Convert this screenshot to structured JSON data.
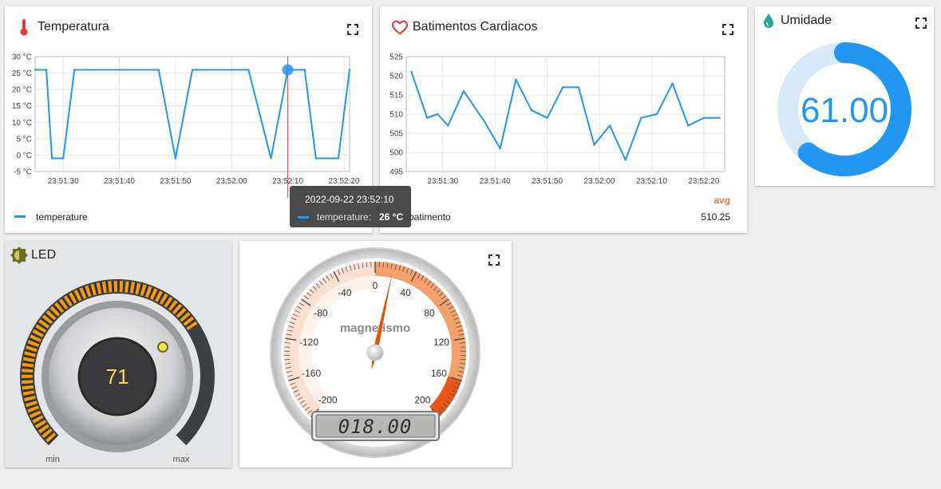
{
  "temperature_card": {
    "title": "Temperatura",
    "icon": "thermometer-icon",
    "legend_label": "temperature",
    "tooltip": {
      "date": "2022-09-22 23:52:10",
      "series": "temperature:",
      "value": "26 °C"
    }
  },
  "heart_card": {
    "title": "Batimentos Cardiacos",
    "icon": "heart-icon",
    "legend_label": "batimento",
    "avg_label": "avg",
    "avg_value": "510.25"
  },
  "humidity_card": {
    "title": "Umidade",
    "icon": "water-drop-icon",
    "value_text": "61.00",
    "value": 61.0,
    "max": 100,
    "colors": {
      "arc": "#2196f3",
      "track": "#d7e9fb"
    }
  },
  "led_card": {
    "title": "LED",
    "icon": "light-bulb-icon",
    "value": "71",
    "min_label": "min",
    "max_label": "max",
    "level": 0.71
  },
  "gauge_card": {
    "title": "magnetismo",
    "lcd_value": "018.00",
    "value": 18,
    "min": -200,
    "max": 200,
    "tick_labels": [
      "-200",
      "-160",
      "-120",
      "-80",
      "-40",
      "0",
      "40",
      "80",
      "120",
      "160",
      "200"
    ]
  },
  "chart_data": [
    {
      "type": "line",
      "title": "Temperatura",
      "series": [
        {
          "name": "temperature",
          "x": [
            "23:51:25",
            "23:51:27",
            "23:51:28",
            "23:51:30",
            "23:51:32",
            "23:51:34",
            "23:51:41",
            "23:51:47",
            "23:51:50",
            "23:51:53",
            "23:52:03",
            "23:52:07",
            "23:52:10",
            "23:52:13",
            "23:52:15",
            "23:52:19",
            "23:52:21"
          ],
          "values": [
            26,
            26,
            -1,
            -1,
            26,
            26,
            26,
            26,
            -1,
            26,
            26,
            -1,
            26,
            26,
            -1,
            -1,
            26
          ]
        }
      ],
      "x_ticks": [
        "23:51:30",
        "23:51:40",
        "23:51:50",
        "23:52:00",
        "23:52:10",
        "23:52:20"
      ],
      "y_ticks": [
        "30 °C",
        "25 °C",
        "20 °C",
        "15 °C",
        "10 °C",
        "5 °C",
        "0 °C",
        "-5 °C"
      ],
      "ylim": [
        -5,
        30
      ],
      "grid": true,
      "legend": "bottom-left",
      "color": "#2196f3"
    },
    {
      "type": "line",
      "title": "Batimentos Cardiacos",
      "series": [
        {
          "name": "batimento",
          "x": [
            "23:51:24",
            "23:51:27",
            "23:51:29",
            "23:51:31",
            "23:51:34",
            "23:51:38",
            "23:51:41",
            "23:51:44",
            "23:51:47",
            "23:51:50",
            "23:51:53",
            "23:51:56",
            "23:51:59",
            "23:52:02",
            "23:52:05",
            "23:52:08",
            "23:52:11",
            "23:52:14",
            "23:52:17",
            "23:52:20",
            "23:52:23"
          ],
          "values": [
            521,
            509,
            510,
            507,
            516,
            508,
            501,
            519,
            511,
            509,
            517,
            517,
            502,
            507,
            498,
            509,
            510,
            518,
            507,
            509,
            509
          ]
        }
      ],
      "x_ticks": [
        "23:51:30",
        "23:51:40",
        "23:51:50",
        "23:52:00",
        "23:52:10",
        "23:52:20"
      ],
      "y_ticks": [
        "525",
        "520",
        "515",
        "510",
        "505",
        "500",
        "495"
      ],
      "ylim": [
        495,
        525
      ],
      "grid": true,
      "legend": "bottom-left",
      "color": "#2196f3"
    }
  ]
}
